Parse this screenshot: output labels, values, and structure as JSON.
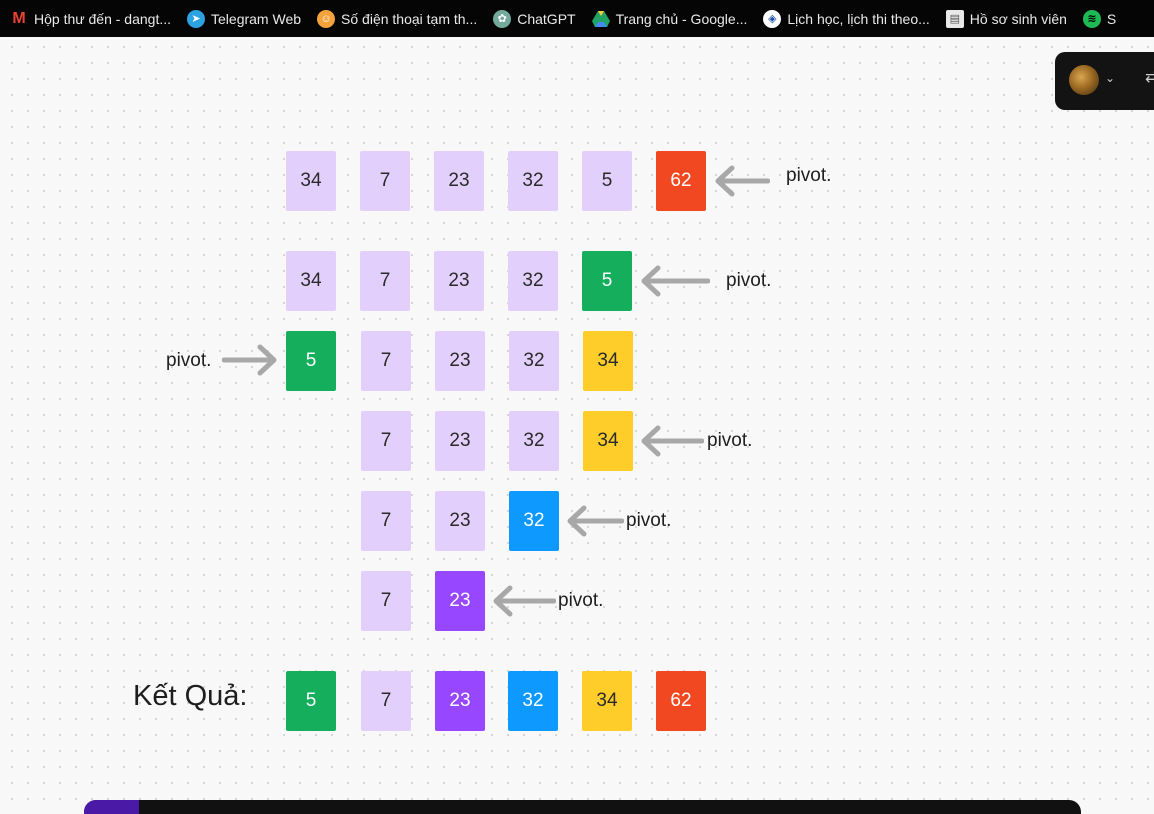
{
  "bookmarks": [
    {
      "label": "Hộp thư đến - dangt...",
      "icon": "gmail-icon",
      "color": "#ea4335"
    },
    {
      "label": "Telegram Web",
      "icon": "telegram-icon",
      "color": "#2aa3e0"
    },
    {
      "label": "Số điện thoại tạm th...",
      "icon": "phone-icon",
      "color": "#f4a23c"
    },
    {
      "label": "ChatGPT",
      "icon": "chatgpt-icon",
      "color": "#74aa9c"
    },
    {
      "label": "Trang chủ - Google...",
      "icon": "google-drive-icon",
      "color": "#1fa463"
    },
    {
      "label": "Lịch học, lịch thi theo...",
      "icon": "university-icon",
      "color": "#2350a8"
    },
    {
      "label": "Hồ sơ sinh viên",
      "icon": "document-icon",
      "color": "#e9e9e9"
    },
    {
      "label": "S",
      "icon": "spotify-icon",
      "color": "#1db954"
    }
  ],
  "diagram": {
    "pivot_label": "pivot.",
    "rows": [
      [
        "34",
        "7",
        "23",
        "32",
        "5",
        "62"
      ],
      [
        "34",
        "7",
        "23",
        "32",
        "5"
      ],
      [
        "5",
        "7",
        "23",
        "32",
        "34"
      ],
      [
        "7",
        "23",
        "32",
        "34"
      ],
      [
        "7",
        "23",
        "32"
      ],
      [
        "7",
        "23"
      ]
    ],
    "result_label": "Kết Quả:",
    "result": [
      "5",
      "7",
      "23",
      "32",
      "34",
      "62"
    ]
  },
  "colors": {
    "default": "#e3cffb",
    "red": "#f24822",
    "green": "#14ae5c",
    "yellow": "#ffcd29",
    "blue": "#0d99ff",
    "purple": "#9747ff"
  }
}
